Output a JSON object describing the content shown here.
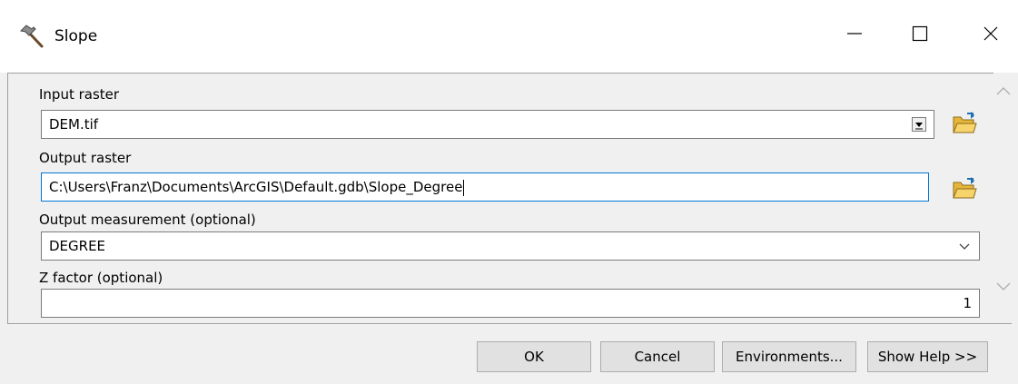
{
  "window": {
    "title": "Slope",
    "icon": "hammer-icon",
    "controls": {
      "minimize": "minimize-icon",
      "maximize": "maximize-icon",
      "close": "close-icon"
    }
  },
  "form": {
    "input_raster": {
      "label": "Input raster",
      "value": "DEM.tif"
    },
    "output_raster": {
      "label": "Output raster",
      "value": "C:\\Users\\Franz\\Documents\\ArcGIS\\Default.gdb\\Slope_Degree"
    },
    "output_measurement": {
      "label": "Output measurement (optional)",
      "value": "DEGREE"
    },
    "z_factor": {
      "label": "Z factor (optional)",
      "value": "1"
    }
  },
  "buttons": {
    "ok": "OK",
    "cancel": "Cancel",
    "environments": "Environments...",
    "show_help": "Show Help >>"
  }
}
